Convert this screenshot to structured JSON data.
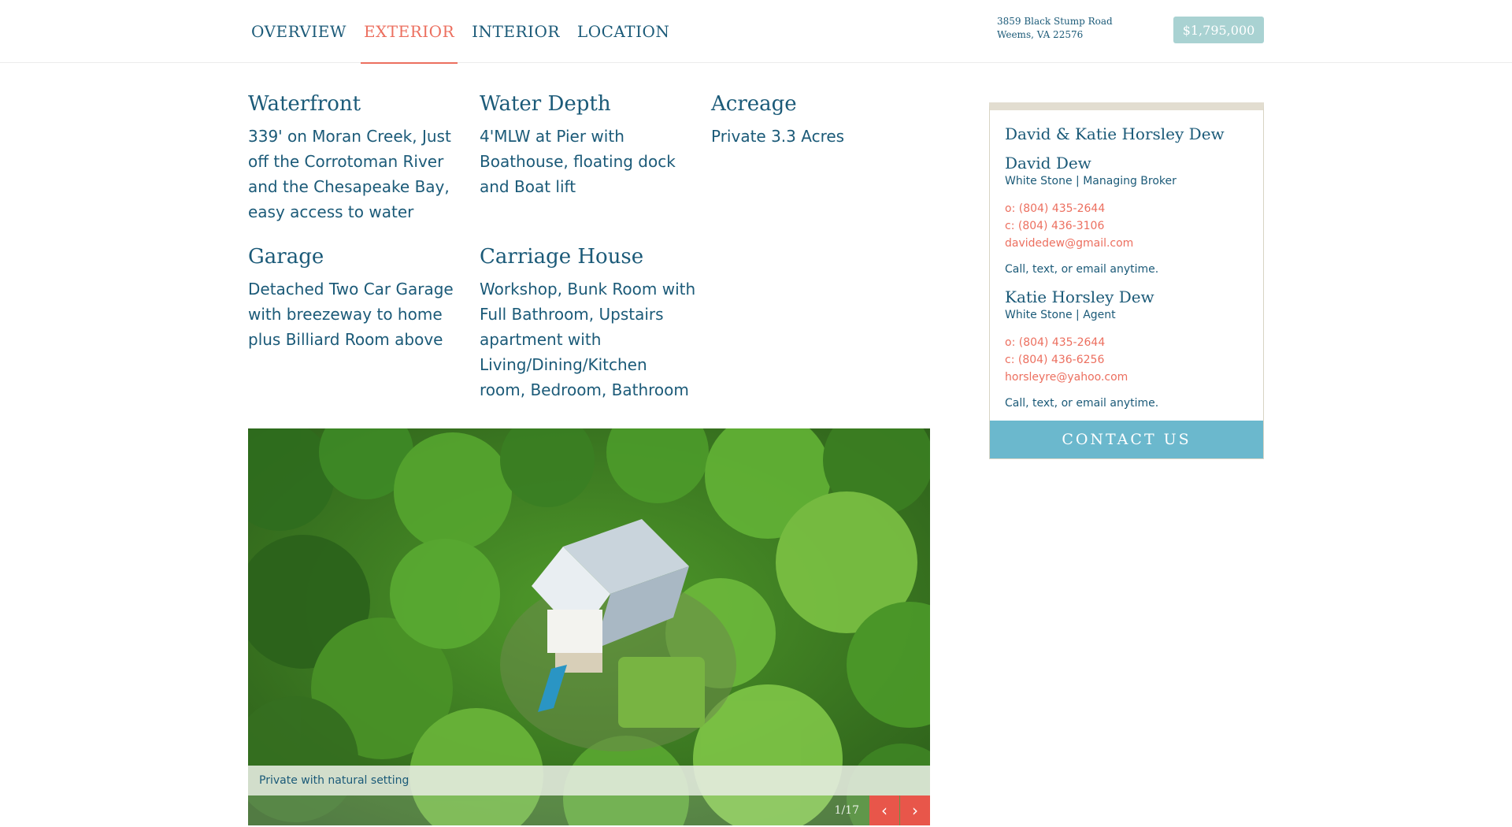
{
  "nav": {
    "tabs": [
      {
        "label": "OVERVIEW"
      },
      {
        "label": "EXTERIOR"
      },
      {
        "label": "INTERIOR"
      },
      {
        "label": "LOCATION"
      }
    ],
    "active_tab": "EXTERIOR",
    "address_line1": "3859 Black Stump Road",
    "address_line2": "Weems, VA 22576",
    "price": "$1,795,000"
  },
  "features": [
    {
      "title": "Waterfront",
      "text": "339' on Moran Creek, Just off the Corrotoman River and the Chesapeake Bay, easy access to water"
    },
    {
      "title": "Water Depth",
      "text": "4'MLW at Pier with Boathouse, floating dock and Boat lift"
    },
    {
      "title": "Acreage",
      "text": "Private 3.3 Acres"
    },
    {
      "title": "Garage",
      "text": "Detached Two Car Garage with breezeway to home plus Billiard Room above"
    },
    {
      "title": "Carriage House",
      "text": "Workshop, Bunk Room with Full Bathroom, Upstairs apartment with Living/Dining/Kitchen room, Bedroom, Bathroom"
    }
  ],
  "gallery": {
    "caption": "Private with natural setting",
    "counter": "1/17"
  },
  "contact": {
    "team": "David & Katie Horsley Dew",
    "agents": [
      {
        "name": "David Dew",
        "role": "White Stone | Managing Broker",
        "office": "o: (804) 435-2644",
        "cell": "c: (804) 436-3106",
        "email": "davidedew@gmail.com",
        "note": "Call, text, or email anytime."
      },
      {
        "name": "Katie Horsley Dew",
        "role": "White Stone | Agent",
        "office": "o: (804) 435-2644",
        "cell": "c: (804) 436-6256",
        "email": "horsleyre@yahoo.com",
        "note": "Call, text, or email anytime."
      }
    ],
    "button_label": "CONTACT US"
  },
  "colors": {
    "primary_text": "#1b5a78",
    "accent": "#ec6f5f",
    "price_badge": "#a9d2d2",
    "contact_button": "#6bb8cd",
    "arrow_button": "#e8564a"
  },
  "icons": {
    "prev": "chevron-left-icon",
    "next": "chevron-right-icon"
  }
}
